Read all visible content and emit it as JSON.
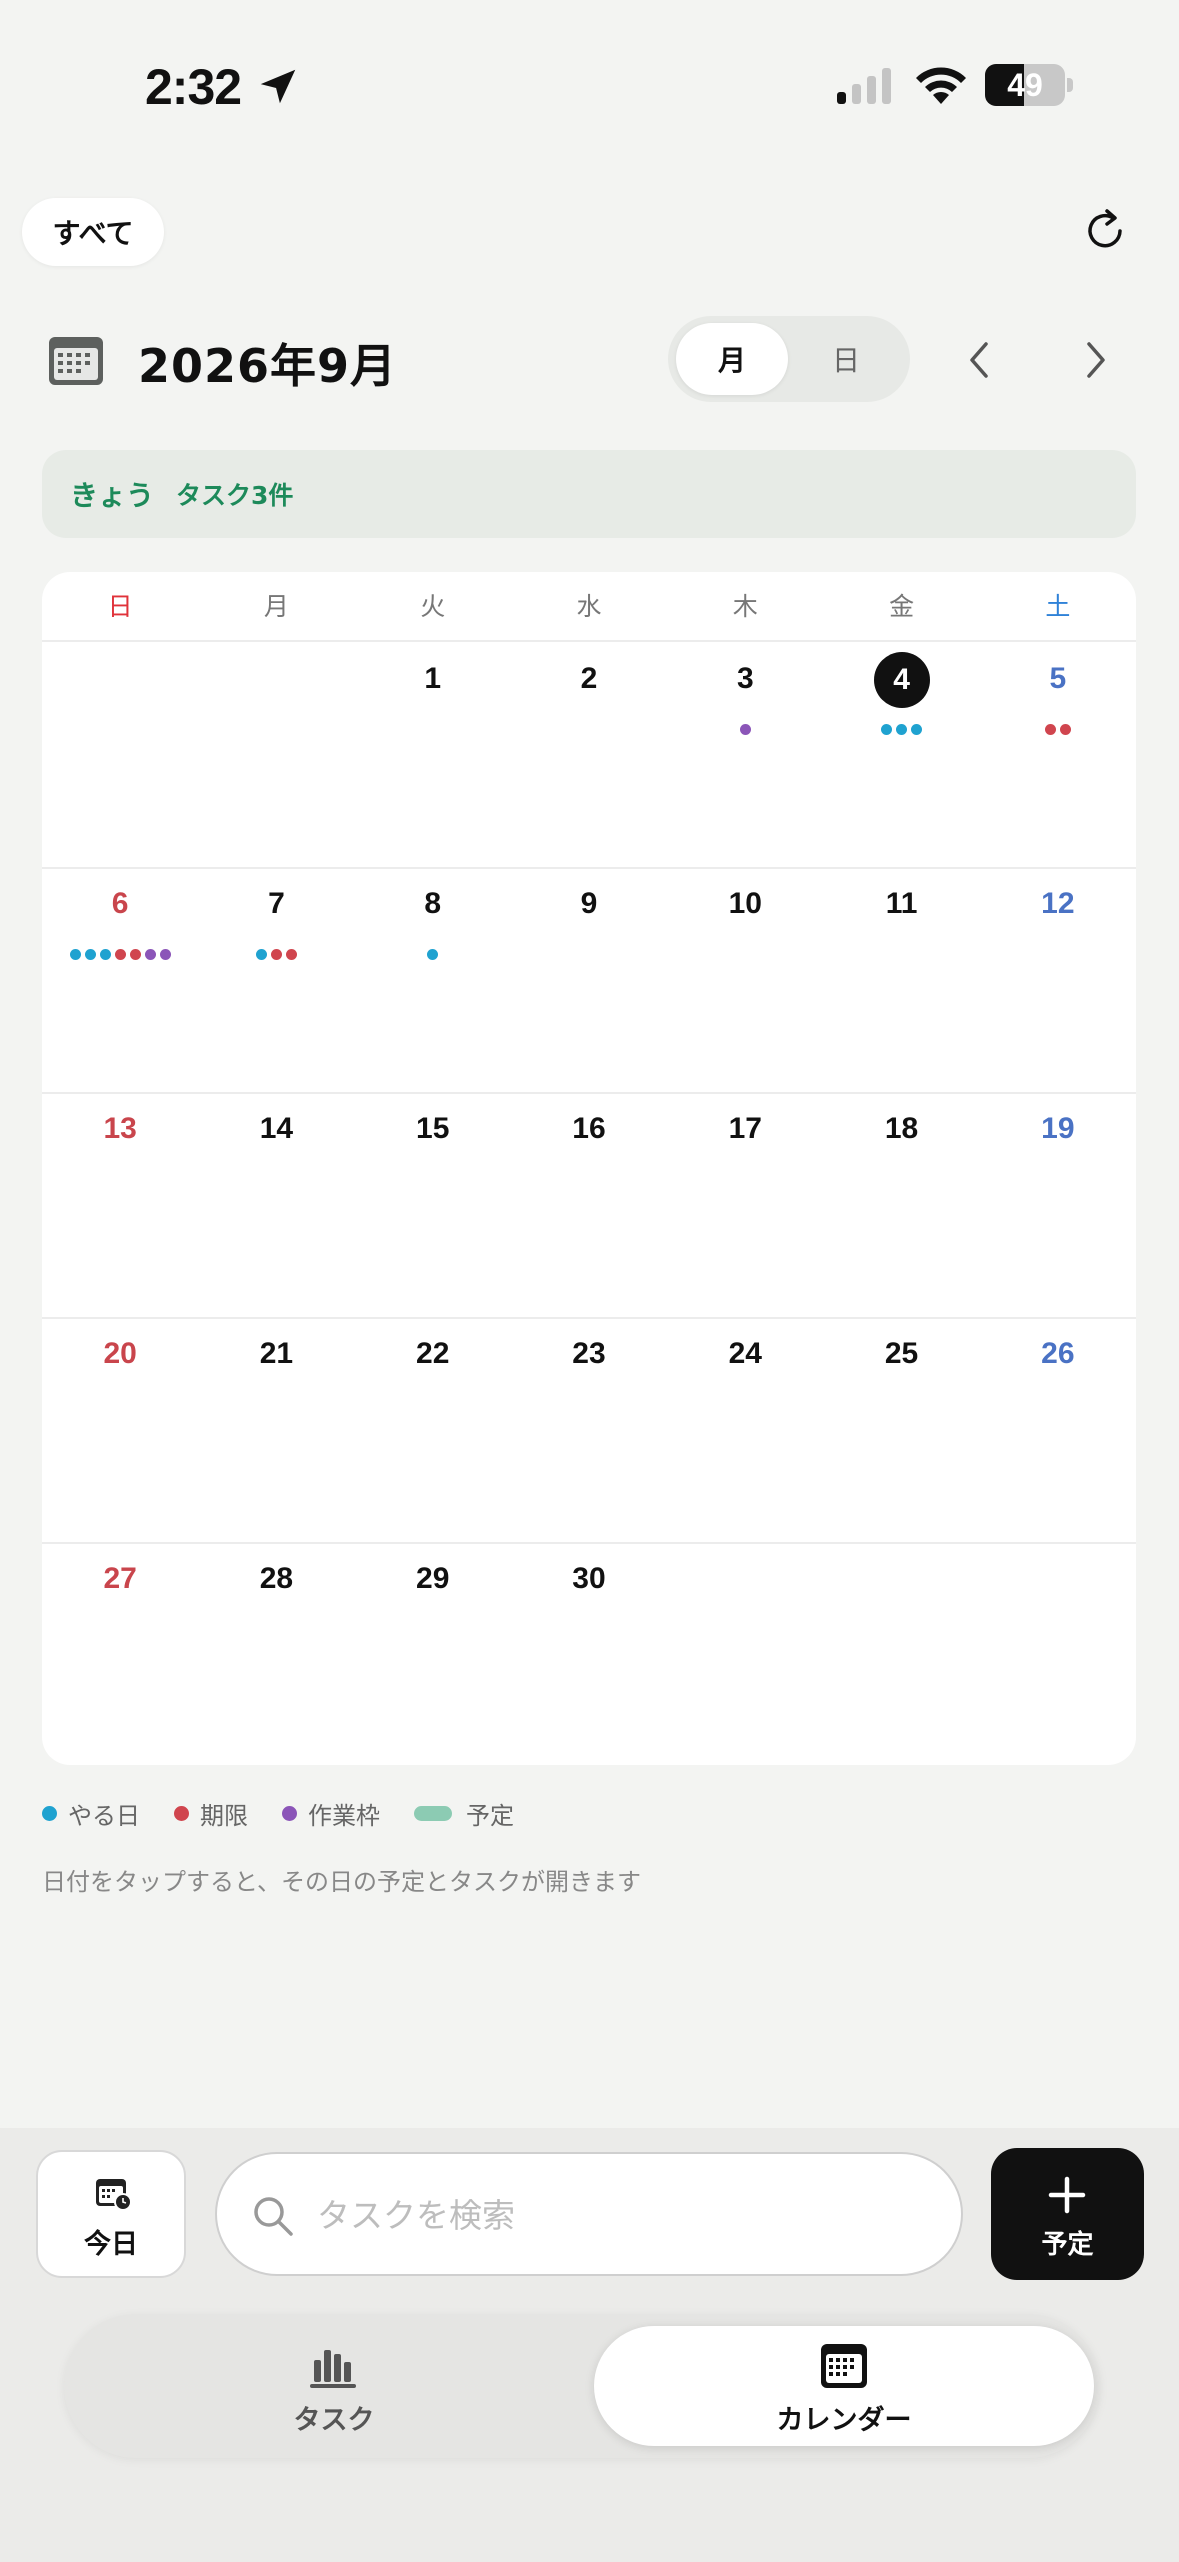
{
  "status_bar": {
    "time": "2:32",
    "battery": "49",
    "battery_level": 0.49
  },
  "filter": {
    "all_label": "すべて"
  },
  "header": {
    "title": "2026年9月",
    "view_month": "月",
    "view_day": "日"
  },
  "today_banner": {
    "label": "きょう",
    "count": "タスク3件"
  },
  "calendar": {
    "weekdays": [
      "日",
      "月",
      "火",
      "水",
      "木",
      "金",
      "土"
    ],
    "weeks": [
      [
        {
          "day": ""
        },
        {
          "day": ""
        },
        {
          "day": "1"
        },
        {
          "day": "2"
        },
        {
          "day": "3",
          "dots": [
            "purple"
          ]
        },
        {
          "day": "4",
          "today": true,
          "dots": [
            "blue",
            "blue",
            "blue"
          ]
        },
        {
          "day": "5",
          "dots": [
            "red",
            "red"
          ]
        }
      ],
      [
        {
          "day": "6",
          "dots": [
            "blue",
            "blue",
            "blue",
            "red",
            "red",
            "purple",
            "purple"
          ]
        },
        {
          "day": "7",
          "dots": [
            "blue",
            "red",
            "red"
          ]
        },
        {
          "day": "8",
          "dots": [
            "blue"
          ]
        },
        {
          "day": "9"
        },
        {
          "day": "10"
        },
        {
          "day": "11"
        },
        {
          "day": "12"
        }
      ],
      [
        {
          "day": "13"
        },
        {
          "day": "14"
        },
        {
          "day": "15"
        },
        {
          "day": "16"
        },
        {
          "day": "17"
        },
        {
          "day": "18"
        },
        {
          "day": "19"
        }
      ],
      [
        {
          "day": "20"
        },
        {
          "day": "21"
        },
        {
          "day": "22"
        },
        {
          "day": "23"
        },
        {
          "day": "24"
        },
        {
          "day": "25"
        },
        {
          "day": "26"
        }
      ],
      [
        {
          "day": "27"
        },
        {
          "day": "28"
        },
        {
          "day": "29"
        },
        {
          "day": "30"
        },
        {
          "day": ""
        },
        {
          "day": ""
        },
        {
          "day": ""
        }
      ]
    ]
  },
  "legend": {
    "do_day": "やる日",
    "deadline": "期限",
    "work_slot": "作業枠",
    "schedule": "予定"
  },
  "hint": "日付をタップすると、その日の予定とタスクが開きます",
  "bottom": {
    "today_button": "今日",
    "search_placeholder": "タスクを検索",
    "add_button": "予定"
  },
  "tabs": {
    "tasks": "タスク",
    "calendar": "カレンダー"
  },
  "colors": {
    "blue": "#1fa2d0",
    "red": "#d0454e",
    "purple": "#8b55b8",
    "green": "#8ccbb3",
    "sunday": "#c9454c",
    "saturday": "#4a72c4",
    "weekday_sun_header": "#e0323a",
    "weekday_sat_header": "#2f82d8"
  }
}
